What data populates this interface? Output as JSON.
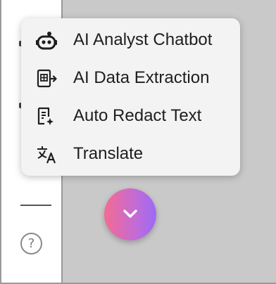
{
  "menu": {
    "items": [
      {
        "label": "AI Analyst Chatbot",
        "icon": "robot-icon"
      },
      {
        "label": "AI Data Extraction",
        "icon": "data-extraction-icon"
      },
      {
        "label": "Auto Redact Text",
        "icon": "redact-document-icon"
      },
      {
        "label": "Translate",
        "icon": "translate-icon"
      }
    ]
  },
  "sidebar": {
    "help_glyph": "?"
  },
  "fab": {
    "icon": "chevron-down-icon",
    "gradient": [
      "#f46b92",
      "#9c6af5"
    ]
  }
}
